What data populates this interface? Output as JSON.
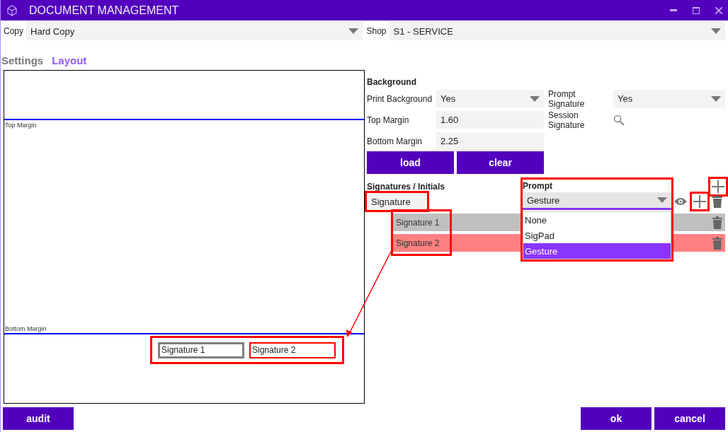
{
  "window": {
    "title": "DOCUMENT MANAGEMENT"
  },
  "filters": [
    {
      "label": "Copy",
      "value": "Hard Copy"
    },
    {
      "label": "Shop",
      "value": "S1 - SERVICE"
    }
  ],
  "tabs": [
    {
      "label": "Settings",
      "selected": false
    },
    {
      "label": "Layout",
      "selected": true
    }
  ],
  "canvas": {
    "top_margin_label": "Top Margin",
    "bottom_margin_label": "Bottom Margin",
    "highlighted": true,
    "fields": [
      {
        "label": "Signature 1",
        "color": "#808080"
      },
      {
        "label": "Signature 2",
        "color": "#ff0000"
      }
    ]
  },
  "background": {
    "title": "Background",
    "fields": [
      {
        "label": "Print Background",
        "kind": "dropdown",
        "value": "Yes"
      },
      {
        "label": "Prompt Signature",
        "kind": "dropdown",
        "value": "Yes"
      },
      {
        "label": "Top Margin",
        "kind": "input",
        "value": "1.60"
      },
      {
        "label": "Session Signature",
        "kind": "search"
      },
      {
        "label": "Bottom Margin",
        "kind": "input",
        "value": "2.25"
      }
    ],
    "buttons": [
      "load",
      "clear"
    ]
  },
  "signatures": {
    "title": "Signatures / Initials",
    "add_highlighted": true,
    "group": {
      "name": "Signature",
      "name_highlighted": true,
      "add_highlighted": true,
      "items_highlighted": true,
      "items": [
        {
          "label": "Signature 1",
          "color": "#c0c0c0"
        },
        {
          "label": "Signature 2",
          "color": "#ff8080"
        }
      ]
    },
    "prompt": {
      "label": "Prompt",
      "value": "Gesture",
      "highlighted": true,
      "options": [
        {
          "label": "None",
          "selected": false
        },
        {
          "label": "SigPad",
          "selected": false
        },
        {
          "label": "Gesture",
          "selected": true
        }
      ]
    }
  },
  "footer": {
    "left": [
      "audit"
    ],
    "right": [
      "ok",
      "cancel"
    ]
  }
}
